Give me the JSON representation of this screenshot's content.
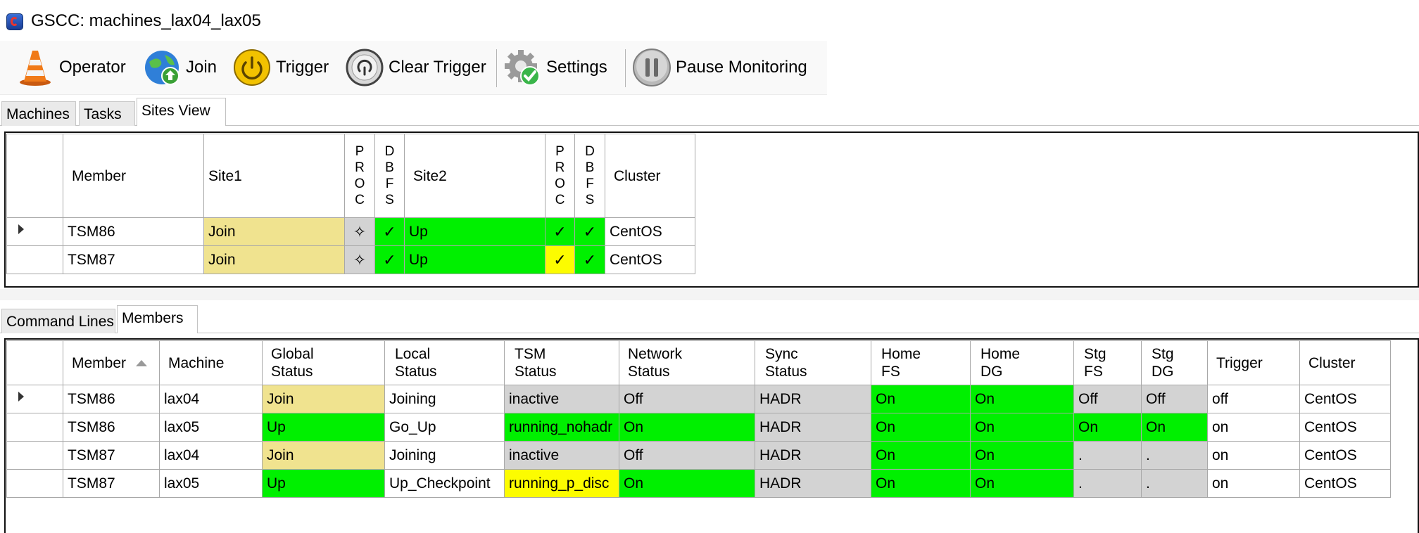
{
  "window": {
    "title": "GSCC: machines_lax04_lax05"
  },
  "toolbar": {
    "operator_label": "Operator",
    "join_label": "Join",
    "trigger_label": "Trigger",
    "clear_trigger_label": "Clear Trigger",
    "settings_label": "Settings",
    "pause_monitoring_label": "Pause Monitoring",
    "icons": [
      "traffic-cone-icon",
      "globe-icon",
      "power-icon",
      "reset-icon",
      "gear-check-icon",
      "pause-icon"
    ]
  },
  "top_tabs": [
    "Machines",
    "Tasks",
    "Sites View"
  ],
  "top_tabs_active": "Sites View",
  "sites_view": {
    "headers": {
      "member": "Member",
      "site1": "Site1",
      "proc1": [
        "P",
        "R",
        "O",
        "C"
      ],
      "dbfs1": [
        "D",
        "B",
        "F",
        "S"
      ],
      "site2": "Site2",
      "proc2": [
        "P",
        "R",
        "O",
        "C"
      ],
      "dbfs2": [
        "D",
        "B",
        "F",
        "S"
      ],
      "cluster": "Cluster"
    },
    "rows": [
      {
        "member": "TSM86",
        "site1": "Join",
        "proc1": "✧",
        "dbfs1": "✓",
        "site2": "Up",
        "proc2": "✓",
        "dbfs2": "✓",
        "cluster": "CentOS"
      },
      {
        "member": "TSM87",
        "site1": "Join",
        "proc1": "✧",
        "dbfs1": "✓",
        "site2": "Up",
        "proc2": "✓",
        "dbfs2": "✓",
        "cluster": "CentOS"
      }
    ]
  },
  "bottom_tabs": [
    "Command Lines",
    "Members"
  ],
  "bottom_tabs_active": "Members",
  "members": {
    "headers": {
      "member": "Member",
      "machine": "Machine",
      "global_status": [
        "Global",
        "Status"
      ],
      "local_status": [
        "Local",
        "Status"
      ],
      "tsm_status": [
        "TSM",
        "Status"
      ],
      "network_status": [
        "Network",
        "Status"
      ],
      "sync_status": [
        "Sync",
        "Status"
      ],
      "home_fs": [
        "Home",
        "FS"
      ],
      "home_dg": [
        "Home",
        "DG"
      ],
      "stg_fs": [
        "Stg",
        "FS"
      ],
      "stg_dg": [
        "Stg",
        "DG"
      ],
      "trigger": "Trigger",
      "cluster": "Cluster"
    },
    "rows": [
      {
        "member": "TSM86",
        "machine": "lax04",
        "global_status": "Join",
        "local_status": "Joining",
        "tsm_status": "inactive",
        "network_status": "Off",
        "sync_status": "HADR",
        "home_fs": "On",
        "home_dg": "On",
        "stg_fs": "Off",
        "stg_dg": "Off",
        "trigger": "off",
        "cluster": "CentOS"
      },
      {
        "member": "TSM86",
        "machine": "lax05",
        "global_status": "Up",
        "local_status": "Go_Up",
        "tsm_status": "running_nohadr",
        "network_status": "On",
        "sync_status": "HADR",
        "home_fs": "On",
        "home_dg": "On",
        "stg_fs": "On",
        "stg_dg": "On",
        "trigger": "on",
        "cluster": "CentOS"
      },
      {
        "member": "TSM87",
        "machine": "lax04",
        "global_status": "Join",
        "local_status": "Joining",
        "tsm_status": "inactive",
        "network_status": "Off",
        "sync_status": "HADR",
        "home_fs": "On",
        "home_dg": "On",
        "stg_fs": ".",
        "stg_dg": ".",
        "trigger": "on",
        "cluster": "CentOS"
      },
      {
        "member": "TSM87",
        "machine": "lax05",
        "global_status": "Up",
        "local_status": "Up_Checkpoint",
        "tsm_status": "running_p_disc",
        "network_status": "On",
        "sync_status": "HADR",
        "home_fs": "On",
        "home_dg": "On",
        "stg_fs": ".",
        "stg_dg": ".",
        "trigger": "on",
        "cluster": "CentOS"
      }
    ]
  },
  "colors": {
    "green": "#00f000",
    "yellow": "#fcfc00",
    "tan": "#f0e38f",
    "gray": "#d3d3d3"
  }
}
